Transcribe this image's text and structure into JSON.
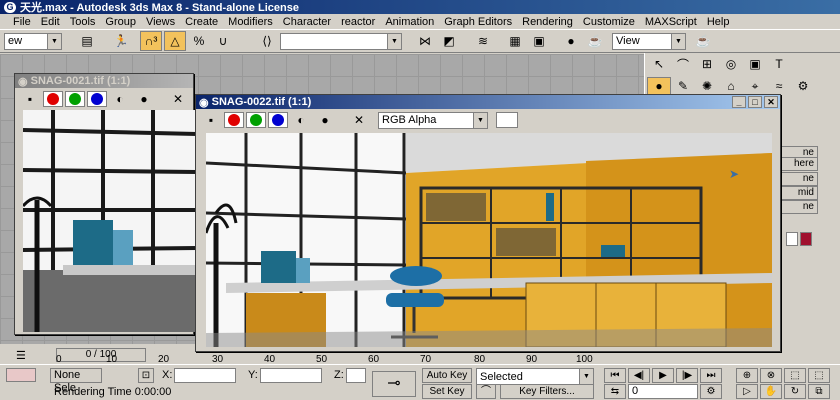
{
  "app": {
    "title": "天光.max - Autodesk 3ds Max 8  - Stand-alone License"
  },
  "menu": [
    "File",
    "Edit",
    "Tools",
    "Group",
    "Views",
    "Create",
    "Modifiers",
    "Character",
    "reactor",
    "Animation",
    "Graph Editors",
    "Rendering",
    "Customize",
    "MAXScript",
    "Help"
  ],
  "toolbar": {
    "selection_filter": "ew",
    "view_combo": "View"
  },
  "windows": {
    "snag21": {
      "title": "SNAG-0021.tif (1:1)"
    },
    "snag22": {
      "title": "SNAG-0022.tif (1:1)",
      "channel": "RGB Alpha"
    }
  },
  "command_panel": {
    "buttons": [
      "ne",
      "here",
      "ne",
      "mid",
      "ne"
    ]
  },
  "timeline": {
    "position": "0 / 100",
    "ticks": [
      "0",
      "10",
      "20",
      "30",
      "40",
      "50",
      "60",
      "70",
      "80",
      "90",
      "100"
    ]
  },
  "status": {
    "selection": "None Sele",
    "x_label": "X:",
    "y_label": "Y:",
    "z_label": "Z:",
    "x_value": "",
    "y_value": "",
    "z_value": "",
    "rendering_time": "Rendering Time  0:00:00",
    "auto_key": "Auto Key",
    "set_key": "Set Key",
    "key_mode": "Selected",
    "key_filters": "Key Filters...",
    "frame": "0"
  },
  "colors": {
    "title_active": "#0a246a",
    "accent_yellow": "#f3c25c",
    "wall_yellow": "#e1a528"
  }
}
